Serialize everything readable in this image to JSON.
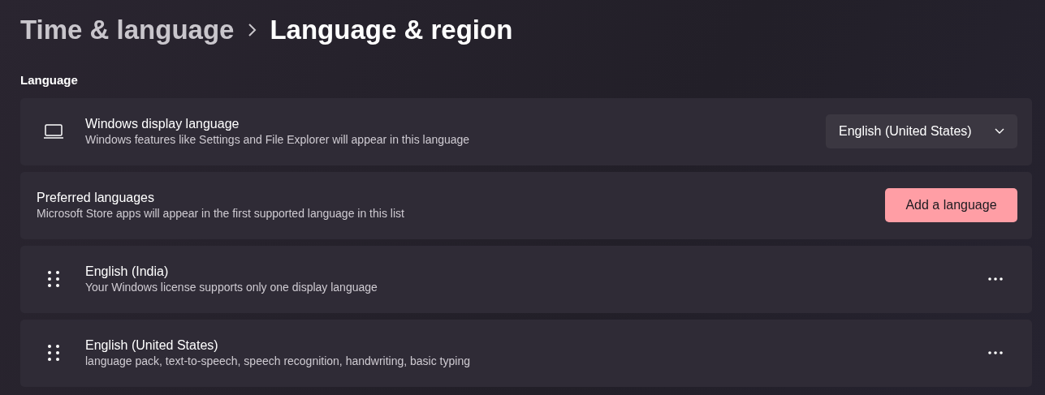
{
  "breadcrumb": {
    "parent": "Time & language",
    "current": "Language & region"
  },
  "section_title": "Language",
  "settings": [
    {
      "kind": "dropdown",
      "title": "Windows display language",
      "description": "Windows features like Settings and File Explorer will appear in this language",
      "value": "English (United States)"
    },
    {
      "kind": "button",
      "title": "Preferred languages",
      "description": "Microsoft Store apps will appear in the first supported language in this list",
      "button_label": "Add a language"
    },
    {
      "kind": "language",
      "title": "English (India)",
      "description": "Your Windows license supports only one display language"
    },
    {
      "kind": "language",
      "title": "English (United States)",
      "description": "language pack, text-to-speech, speech recognition, handwriting, basic typing"
    }
  ]
}
